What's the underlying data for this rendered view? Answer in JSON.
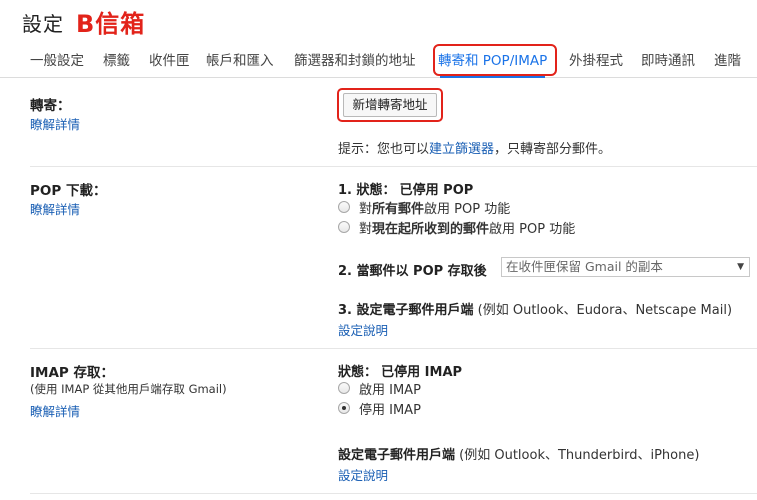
{
  "header": {
    "title": "設定",
    "annotation": "B信箱"
  },
  "tabs": [
    {
      "label": "一般設定"
    },
    {
      "label": "標籤"
    },
    {
      "label": "收件匣"
    },
    {
      "label": "帳戶和匯入"
    },
    {
      "label": "篩選器和封鎖的地址"
    },
    {
      "label": "轉寄和 POP/IMAP",
      "active": true
    },
    {
      "label": "外掛程式"
    },
    {
      "label": "即時通訊"
    },
    {
      "label": "進階"
    }
  ],
  "forwarding": {
    "title": "轉寄：",
    "learn_more": "瞭解詳情",
    "add_button": "新增轉寄地址",
    "tip_prefix": "提示：您也可以",
    "tip_link": "建立篩選器",
    "tip_suffix": "，只轉寄部分郵件。"
  },
  "pop": {
    "title": "POP 下載：",
    "learn_more": "瞭解詳情",
    "status_label": "1. 狀態：",
    "status_value": "已停用 POP",
    "option1_prefix": "對",
    "option1_bold": "所有郵件",
    "option1_suffix": "啟用 POP 功能",
    "option2_prefix": "對",
    "option2_bold": "現在起所收到的郵件",
    "option2_suffix": "啟用 POP 功能",
    "access_label": "2. 當郵件以 POP 存取後",
    "access_select": "在收件匣保留 Gmail 的副本",
    "client_label": "3. 設定電子郵件用戶端",
    "client_note": "(例如 Outlook、Eudora、Netscape Mail)",
    "setup_link": "設定說明"
  },
  "imap": {
    "title": "IMAP 存取：",
    "subtitle": "(使用 IMAP 從其他用戶端存取 Gmail)",
    "learn_more": "瞭解詳情",
    "status_label": "狀態：",
    "status_value": "已停用 IMAP",
    "option_enable": "啟用 IMAP",
    "option_disable": "停用 IMAP",
    "disable_checked": true,
    "client_label": "設定電子郵件用戶端",
    "client_note": "(例如 Outlook、Thunderbird、iPhone)",
    "setup_link": "設定說明"
  },
  "colors": {
    "accent": "#1a73e8",
    "link": "#1a5fb4",
    "annotation": "#e2231a"
  }
}
